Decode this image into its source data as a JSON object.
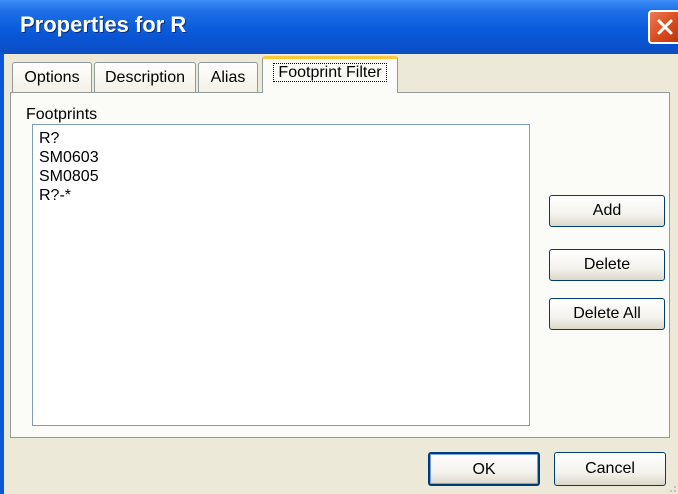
{
  "window": {
    "title": "Properties for R"
  },
  "tabs": [
    {
      "label": "Options",
      "active": false
    },
    {
      "label": "Description",
      "active": false
    },
    {
      "label": "Alias",
      "active": false
    },
    {
      "label": "Footprint Filter",
      "active": true
    }
  ],
  "footprints": {
    "label": "Footprints",
    "items": [
      "R?",
      "SM0603",
      "SM0805",
      "R?-*"
    ]
  },
  "side_buttons": {
    "add": "Add",
    "delete": "Delete",
    "delete_all": "Delete All"
  },
  "dialog_buttons": {
    "ok": "OK",
    "cancel": "Cancel"
  },
  "icons": {
    "close": "close-icon",
    "grip": "resize-grip-icon"
  },
  "colors": {
    "titlebar": "#0a5bdc",
    "close": "#d84a1c",
    "dialog_bg": "#ece9d8",
    "active_tab_accent": "#ffc83c"
  }
}
